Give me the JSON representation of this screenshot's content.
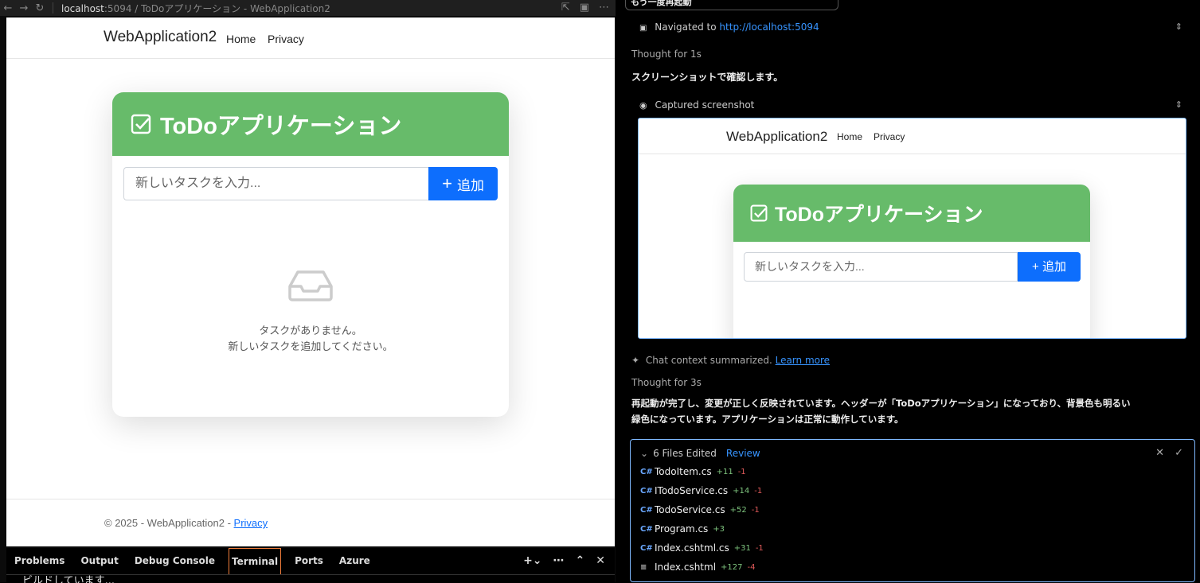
{
  "browser": {
    "url_host": "localhost",
    "url_rest": ":5094 / ToDoアプリケーション - WebApplication2"
  },
  "site": {
    "brand": "WebApplication2",
    "nav_home": "Home",
    "nav_privacy": "Privacy",
    "app_title": "ToDoアプリケーション",
    "input_placeholder": "新しいタスクを入力...",
    "add_button": "追加",
    "empty_line1": "タスクがありません。",
    "empty_line2": "新しいタスクを追加してください。",
    "footer_text": "© 2025 - WebApplication2 - ",
    "footer_link": "Privacy",
    "header_color": "#67bb6a",
    "button_color": "#0d6efd"
  },
  "panel": {
    "tabs": [
      "Problems",
      "Output",
      "Debug Console",
      "Terminal",
      "Ports",
      "Azure"
    ],
    "active_tab": "Terminal",
    "terminal_text": "ビルドしています..."
  },
  "chat": {
    "top_item": "もう一度再起動",
    "navigated_label": "Navigated to",
    "navigated_url": "http://localhost:5094",
    "thought1": "Thought for 1s",
    "msg1": "スクリーンショットで確認します。",
    "captured_label": "Captured screenshot",
    "summarized_label": "Chat context summarized.",
    "learn_more": "Learn more",
    "thought2": "Thought for 3s",
    "msg2_line1": "再起動が完了し、変更が正しく反映されています。ヘッダーが「ToDoアプリケーション」になっており、背景色も明るい",
    "msg2_line2": "緑色になっています。アプリケーションは正常に動作しています。",
    "files_edited": "6 Files Edited",
    "review": "Review",
    "files": [
      {
        "name": "TodoItem.cs",
        "added": "+11",
        "removed": "-1",
        "icon": "csharp-icon"
      },
      {
        "name": "ITodoService.cs",
        "added": "+14",
        "removed": "-1",
        "icon": "csharp-icon"
      },
      {
        "name": "TodoService.cs",
        "added": "+52",
        "removed": "-1",
        "icon": "csharp-icon"
      },
      {
        "name": "Program.cs",
        "added": "+3",
        "removed": "",
        "icon": "csharp-icon"
      },
      {
        "name": "Index.cshtml.cs",
        "added": "+31",
        "removed": "-1",
        "icon": "csharp-icon"
      },
      {
        "name": "Index.cshtml",
        "added": "+127",
        "removed": "-4",
        "icon": "lines-icon"
      }
    ]
  }
}
